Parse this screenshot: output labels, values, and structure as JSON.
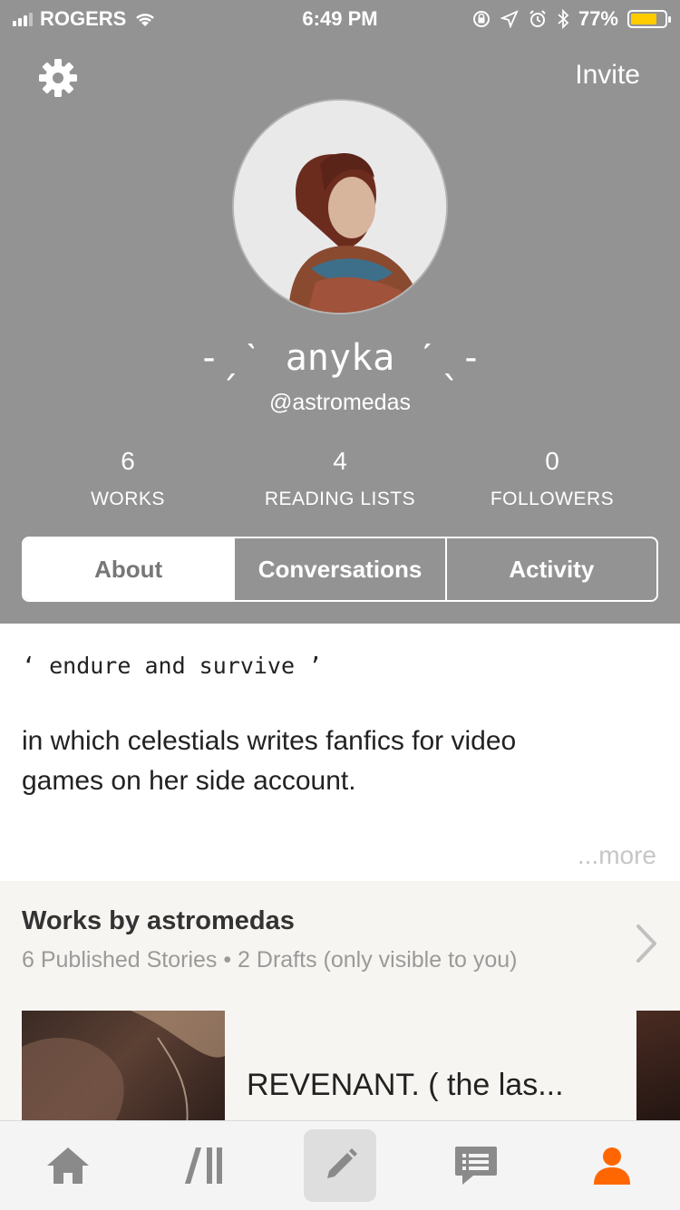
{
  "status_bar": {
    "carrier": "ROGERS",
    "time": "6:49 PM",
    "battery_percent": "77%",
    "battery_level": 0.77,
    "battery_color": "#ffcc00"
  },
  "header": {
    "invite_label": "Invite",
    "background_color": "#939393"
  },
  "profile": {
    "display_name": "-ˏˋ anyka ˊˎ-",
    "username": "@astromedas"
  },
  "stats": [
    {
      "value": "6",
      "label": "WORKS"
    },
    {
      "value": "4",
      "label": "READING LISTS"
    },
    {
      "value": "0",
      "label": "FOLLOWERS"
    }
  ],
  "tabs": [
    {
      "label": "About",
      "active": true
    },
    {
      "label": "Conversations",
      "active": false
    },
    {
      "label": "Activity",
      "active": false
    }
  ],
  "about": {
    "quote": "‘ endure and survive ’",
    "description": "in which celestials writes fanfics for video games on her side account.",
    "more_label": "...more"
  },
  "works": {
    "title": "Works by astromedas",
    "subtitle": "6 Published Stories • 2 Drafts (only visible to you)",
    "first_story_title": "REVENANT. (  the las..."
  },
  "bottom_nav": [
    {
      "icon": "home-icon"
    },
    {
      "icon": "library-icon"
    },
    {
      "icon": "pencil-icon"
    },
    {
      "icon": "messages-icon"
    },
    {
      "icon": "profile-icon",
      "active_color": "#ff6600"
    }
  ]
}
